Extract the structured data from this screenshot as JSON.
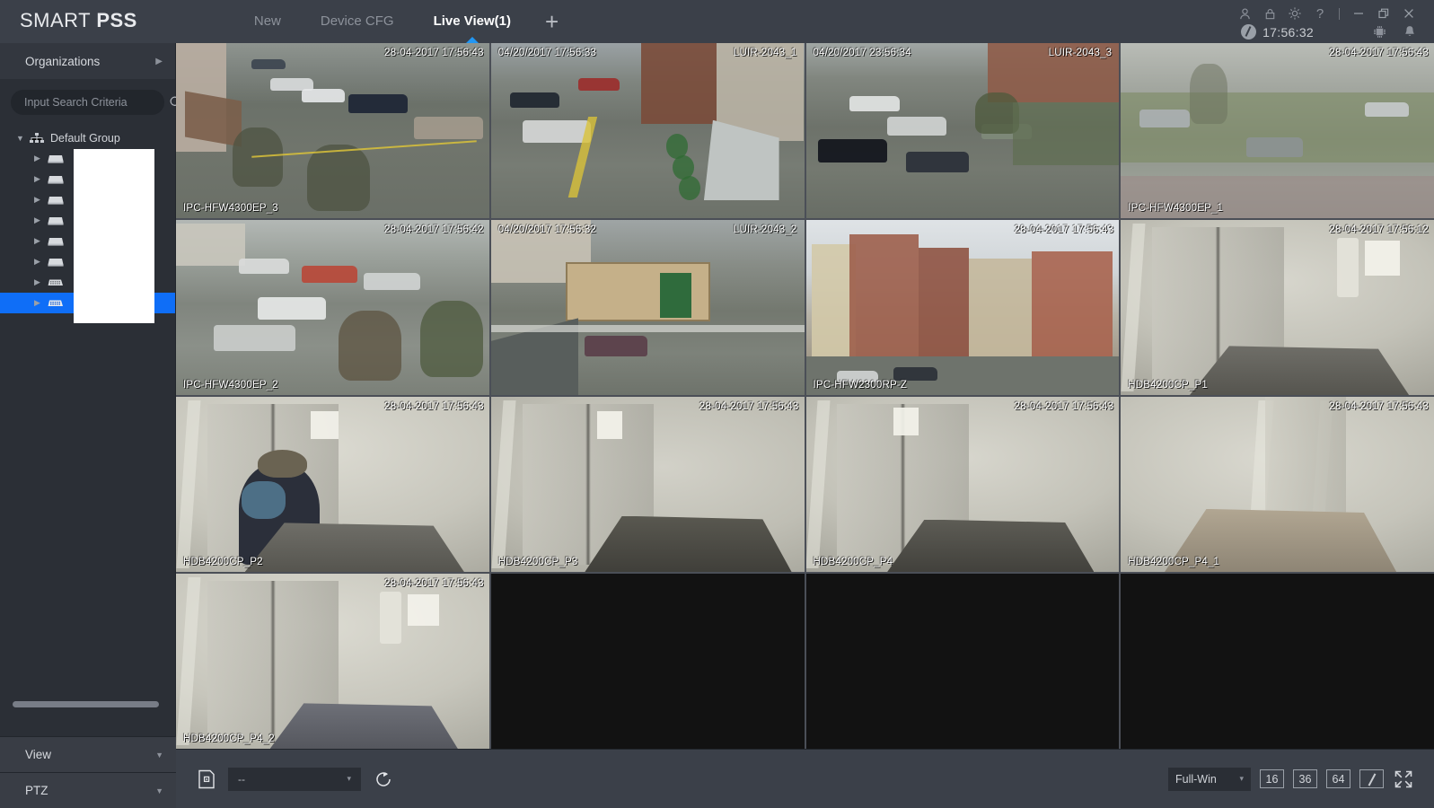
{
  "app": {
    "logo_smart": "SMART ",
    "logo_pss": "PSS"
  },
  "tabs": [
    {
      "label": "New",
      "active": false
    },
    {
      "label": "Device CFG",
      "active": false
    },
    {
      "label": "Live View(1)",
      "active": true
    }
  ],
  "tab_add_label": "+",
  "titlebar": {
    "icons": [
      "user-icon",
      "lock-icon",
      "gear-icon",
      "help-icon"
    ],
    "help_label": "?",
    "window_min": "minimize-icon",
    "window_restore": "restore-icon",
    "window_close": "close-icon",
    "time": "17:56:32",
    "clock_icon": "clock-icon",
    "cpu_icon": "cpu-icon",
    "bell_icon": "bell-icon"
  },
  "sidebar": {
    "header": {
      "label": "Organizations",
      "arrow": "▶"
    },
    "search": {
      "value": "",
      "placeholder": "Input Search Criteria",
      "icon": "search-icon"
    },
    "tree": {
      "root": {
        "label": "Default Group",
        "caret": "▼",
        "icon": "org-tree-icon"
      },
      "devices": [
        {
          "label": "",
          "caret": "▶",
          "icon": "nvr-icon",
          "selected": false
        },
        {
          "label": "",
          "caret": "▶",
          "icon": "nvr-icon",
          "selected": false
        },
        {
          "label": "",
          "caret": "▶",
          "icon": "nvr-icon",
          "selected": false
        },
        {
          "label": "",
          "caret": "▶",
          "icon": "nvr-icon",
          "selected": false
        },
        {
          "label": "",
          "caret": "▶",
          "icon": "nvr-icon",
          "selected": false
        },
        {
          "label": "",
          "caret": "▶",
          "icon": "nvr-icon",
          "selected": false
        },
        {
          "label": "",
          "caret": "▶",
          "icon": "camera-icon",
          "selected": false
        },
        {
          "label": "",
          "caret": "▶",
          "icon": "camera-icon",
          "selected": true
        }
      ]
    },
    "panels": [
      {
        "label": "View",
        "arrow": "▼"
      },
      {
        "label": "PTZ",
        "arrow": "▼"
      }
    ]
  },
  "grid": {
    "rows": 4,
    "cols": 4,
    "tiles": [
      {
        "index": 1,
        "name": "IPC-HFW4300EP_3",
        "timestamp": "28-04-2017 17:56:43",
        "ts_pos": "right",
        "name_pos": "bottom-left",
        "scene": "sc-yard1",
        "empty": false
      },
      {
        "index": 2,
        "name": "LUIR-2043_1",
        "timestamp": "04/20/2017 17:56:33",
        "ts_pos": "left",
        "name_pos": "top-right",
        "scene": "sc-yard2",
        "empty": false
      },
      {
        "index": 3,
        "name": "LUIR-2043_3",
        "timestamp": "04/20/2017 23:56:34",
        "ts_pos": "left",
        "name_pos": "top-right",
        "scene": "sc-yard3",
        "empty": false
      },
      {
        "index": 4,
        "name": "IPC-HFW4300EP_1",
        "timestamp": "28-04-2017 17:56:43",
        "ts_pos": "right",
        "name_pos": "bottom-left",
        "scene": "sc-fog",
        "empty": false
      },
      {
        "index": 5,
        "name": "IPC-HFW4300EP_2",
        "timestamp": "28-04-2017 17:56:42",
        "ts_pos": "right",
        "name_pos": "bottom-left",
        "scene": "sc-yard4",
        "empty": false
      },
      {
        "index": 6,
        "name": "LUIR-2043_2",
        "timestamp": "04/20/2017 17:56:32",
        "ts_pos": "left",
        "name_pos": "top-right",
        "scene": "sc-yard5",
        "empty": false
      },
      {
        "index": 7,
        "name": "IPC-HFW2300RP-Z",
        "timestamp": "28-04-2017 17:56:43",
        "ts_pos": "right",
        "name_pos": "bottom-left",
        "scene": "sc-city",
        "empty": false
      },
      {
        "index": 8,
        "name": "HDB4200CP_P1",
        "timestamp": "28-04-2017 17:56:12",
        "ts_pos": "right",
        "name_pos": "bottom-left",
        "scene": "sc-lift",
        "empty": false
      },
      {
        "index": 9,
        "name": "HDB4200CP_P2",
        "timestamp": "28-04-2017 17:56:43",
        "ts_pos": "right",
        "name_pos": "bottom-left",
        "scene": "sc-lift2",
        "empty": false
      },
      {
        "index": 10,
        "name": "HDB4200CP_P3",
        "timestamp": "28-04-2017 17:56:43",
        "ts_pos": "right",
        "name_pos": "bottom-left",
        "scene": "sc-lift3",
        "empty": false
      },
      {
        "index": 11,
        "name": "HDB4200CP_P4",
        "timestamp": "28-04-2017 17:56:43",
        "ts_pos": "right",
        "name_pos": "bottom-left",
        "scene": "sc-lift",
        "empty": false
      },
      {
        "index": 12,
        "name": "HDB4200CP_P4_1",
        "timestamp": "28-04-2017 17:56:43",
        "ts_pos": "right",
        "name_pos": "bottom-left",
        "scene": "sc-lift4",
        "empty": false
      },
      {
        "index": 13,
        "name": "HDB4200CP_P4_2",
        "timestamp": "28-04-2017 17:56:43",
        "ts_pos": "right",
        "name_pos": "bottom-left",
        "scene": "sc-lift2",
        "empty": false
      },
      {
        "index": 14,
        "name": "",
        "timestamp": "",
        "ts_pos": "right",
        "name_pos": "bottom-left",
        "scene": "",
        "empty": true
      },
      {
        "index": 15,
        "name": "",
        "timestamp": "",
        "ts_pos": "right",
        "name_pos": "bottom-left",
        "scene": "",
        "empty": true
      },
      {
        "index": 16,
        "name": "",
        "timestamp": "",
        "ts_pos": "right",
        "name_pos": "bottom-left",
        "scene": "",
        "empty": true
      }
    ]
  },
  "bottombar": {
    "snapshot_icon": "snapshot-icon",
    "stream_select": {
      "value": "--",
      "caret": "▾"
    },
    "refresh_icon": "refresh-icon",
    "window_mode": {
      "value": "Full-Win",
      "caret": "▾"
    },
    "layout_buttons": [
      "16",
      "36",
      "64"
    ],
    "custom_layout_icon": "custom-layout-icon",
    "fullscreen_icon": "fullscreen-icon"
  },
  "colors": {
    "accent": "#2196f3",
    "selection": "#0f6ef7",
    "titlebar_bg": "#3b4049",
    "sidebar_bg": "#2b2f36",
    "panel_bg": "#393d45"
  }
}
